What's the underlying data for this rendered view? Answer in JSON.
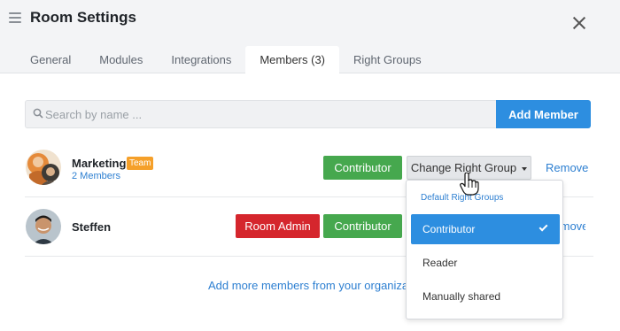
{
  "header": {
    "title": "Room Settings",
    "tabs": [
      {
        "label": "General"
      },
      {
        "label": "Modules"
      },
      {
        "label": "Integrations"
      },
      {
        "label": "Members (3)"
      },
      {
        "label": "Right Groups"
      }
    ],
    "active_tab": "Members (3)"
  },
  "search": {
    "placeholder": "Search by name ...",
    "value": ""
  },
  "add_member_label": "Add Member",
  "members": [
    {
      "name": "Marketing",
      "badge": "Team",
      "sub": "2 Members",
      "right_group": "Contributor",
      "change_label": "Change Right Group",
      "remove_label": "Remove"
    },
    {
      "name": "Steffen",
      "admin_label": "Room Admin",
      "right_group": "Contributor",
      "remove_label": "Remove"
    }
  ],
  "add_more_link": "Add more members from your organization",
  "dropdown": {
    "header": "Default Right Groups",
    "items": [
      {
        "label": "Contributor",
        "selected": true
      },
      {
        "label": "Reader",
        "selected": false
      },
      {
        "label": "Manually shared",
        "selected": false
      }
    ]
  },
  "colors": {
    "primary": "#2d8ee0",
    "contributor": "#46a84e",
    "admin": "#d5262d",
    "team_badge": "#f5a02a"
  }
}
